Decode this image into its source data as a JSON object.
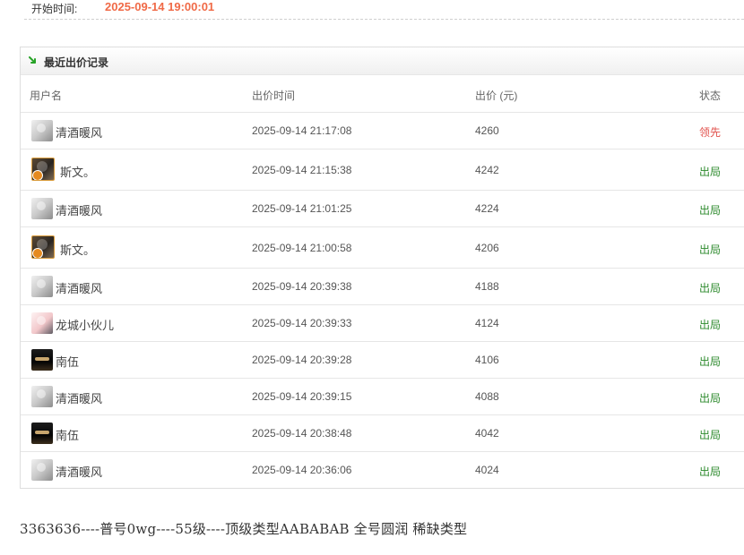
{
  "start": {
    "label": "开始时间:",
    "value": "2025-09-14 19:00:01"
  },
  "panel": {
    "title": "最近出价记录",
    "icon": "green-arrow-down-right-icon",
    "headers": [
      "用户名",
      "出价时间",
      "出价 (元)",
      "状态"
    ],
    "rows": [
      {
        "avatar": "gray",
        "name": "清酒暖风",
        "time": "2025-09-14 21:17:08",
        "price": "4260",
        "status": "领先",
        "status_type": "lead",
        "tall": false
      },
      {
        "avatar": "gold",
        "name": "斯文。",
        "time": "2025-09-14 21:15:38",
        "price": "4242",
        "status": "出局",
        "status_type": "out",
        "tall": true
      },
      {
        "avatar": "gray",
        "name": "清酒暖风",
        "time": "2025-09-14 21:01:25",
        "price": "4224",
        "status": "出局",
        "status_type": "out",
        "tall": false
      },
      {
        "avatar": "gold",
        "name": "斯文。",
        "time": "2025-09-14 21:00:58",
        "price": "4206",
        "status": "出局",
        "status_type": "out",
        "tall": true
      },
      {
        "avatar": "gray",
        "name": "清酒暖风",
        "time": "2025-09-14 20:39:38",
        "price": "4188",
        "status": "出局",
        "status_type": "out",
        "tall": false
      },
      {
        "avatar": "pink",
        "name": "龙城小伙儿",
        "time": "2025-09-14 20:39:33",
        "price": "4124",
        "status": "出局",
        "status_type": "out",
        "tall": false
      },
      {
        "avatar": "black",
        "name": "南伍",
        "time": "2025-09-14 20:39:28",
        "price": "4106",
        "status": "出局",
        "status_type": "out",
        "tall": false
      },
      {
        "avatar": "gray",
        "name": "清酒暖风",
        "time": "2025-09-14 20:39:15",
        "price": "4088",
        "status": "出局",
        "status_type": "out",
        "tall": false
      },
      {
        "avatar": "black",
        "name": "南伍",
        "time": "2025-09-14 20:38:48",
        "price": "4042",
        "status": "出局",
        "status_type": "out",
        "tall": false
      },
      {
        "avatar": "gray",
        "name": "清酒暖风",
        "time": "2025-09-14 20:36:06",
        "price": "4024",
        "status": "出局",
        "status_type": "out",
        "tall": false
      }
    ]
  },
  "footer": {
    "text": "3363636----普号0wg----55级----顶级类型AABABAB 全号圆润 稀缺类型"
  },
  "colors": {
    "start_value": "#f06a47",
    "lead": "#e1504b",
    "out": "#2e8b2e"
  }
}
